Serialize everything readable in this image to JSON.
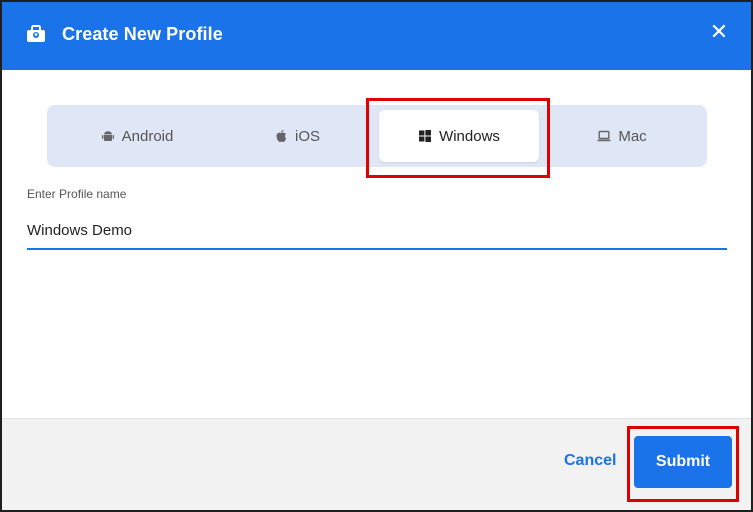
{
  "dialog": {
    "title": "Create New Profile",
    "header_color": "#1a73e8",
    "close_icon": "close-icon"
  },
  "platform_tabs": [
    {
      "label": "Android",
      "icon": "android-icon",
      "selected": false
    },
    {
      "label": "iOS",
      "icon": "apple-icon",
      "selected": false
    },
    {
      "label": "Windows",
      "icon": "windows-icon",
      "selected": true
    },
    {
      "label": "Mac",
      "icon": "laptop-icon",
      "selected": false
    }
  ],
  "profile_name": {
    "label": "Enter Profile name",
    "value": "Windows Demo"
  },
  "footer": {
    "cancel_label": "Cancel",
    "submit_label": "Submit"
  },
  "highlight_color": "#e10000"
}
